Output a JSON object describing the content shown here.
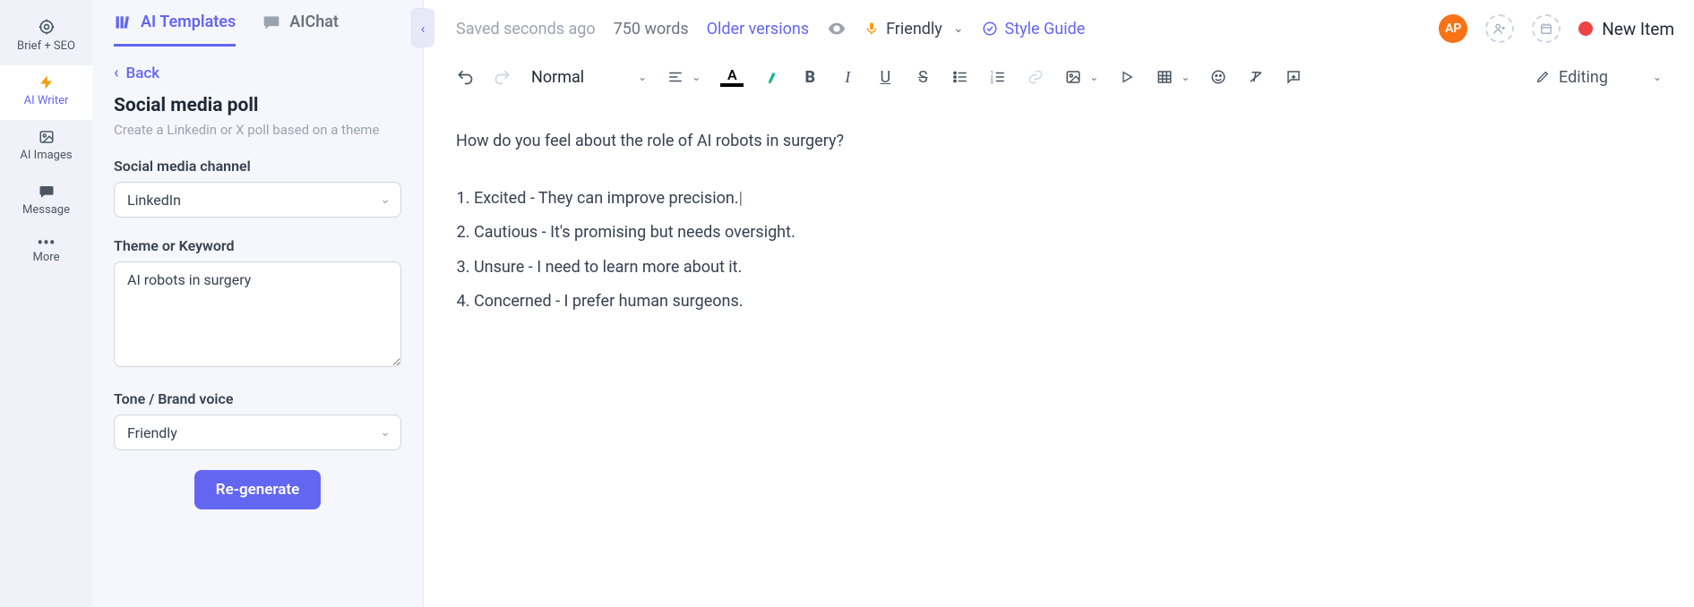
{
  "rail": {
    "items": [
      {
        "label": "Brief + SEO"
      },
      {
        "label": "AI Writer"
      },
      {
        "label": "AI Images"
      },
      {
        "label": "Message"
      },
      {
        "label": "More"
      }
    ]
  },
  "tabs": {
    "templates": "AI Templates",
    "chat": "AIChat"
  },
  "panel": {
    "back": "Back",
    "title": "Social media poll",
    "desc": "Create a Linkedin or X poll based on a theme",
    "channel_label": "Social media channel",
    "channel_value": "LinkedIn",
    "theme_label": "Theme or Keyword",
    "theme_value": "AI robots in surgery",
    "tone_label": "Tone / Brand voice",
    "tone_value": "Friendly",
    "regenerate": "Re-generate"
  },
  "topbar": {
    "saved": "Saved seconds ago",
    "words": "750 words",
    "versions": "Older versions",
    "tone": "Friendly",
    "style_guide": "Style Guide",
    "avatar": "AP",
    "new_item": "New Item"
  },
  "toolbar": {
    "format": "Normal",
    "editing": "Editing"
  },
  "doc": {
    "question": "How do you feel about the role of AI robots in surgery?",
    "options": [
      "Excited - They can improve precision.",
      "Cautious - It's promising but needs oversight.",
      "Unsure - I need to learn more about it.",
      "Concerned - I prefer human surgeons."
    ]
  }
}
